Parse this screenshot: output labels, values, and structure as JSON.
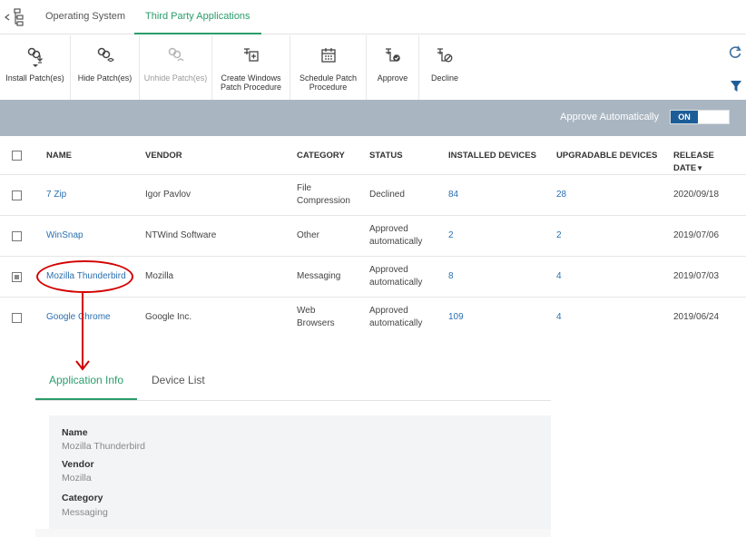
{
  "tabs": [
    {
      "label": "Operating System"
    },
    {
      "label": "Third Party Applications"
    }
  ],
  "toolbar": {
    "install": "Install Patch(es)",
    "hide": "Hide Patch(es)",
    "unhide": "Unhide Patch(es)",
    "create_windows_1": "Create Windows",
    "create_windows_2": "Patch Procedure",
    "schedule_1": "Schedule Patch",
    "schedule_2": "Procedure",
    "approve": "Approve",
    "decline": "Decline"
  },
  "auto": {
    "label": "Approve Automatically",
    "toggle": "ON"
  },
  "table": {
    "headers": {
      "name": "NAME",
      "vendor": "VENDOR",
      "category": "CATEGORY",
      "status": "STATUS",
      "installed": "INSTALLED DEVICES",
      "upgradable": "UPGRADABLE DEVICES",
      "release": "RELEASE DATE",
      "sort": "▼"
    },
    "rows": [
      {
        "name": "7 Zip",
        "vendor": "Igor Pavlov",
        "category_1": "File",
        "category_2": "Compression",
        "status_1": "Declined",
        "status_2": "",
        "installed": "84",
        "upgradable": "28",
        "release": "2020/09/18",
        "checked": false
      },
      {
        "name": "WinSnap",
        "vendor": "NTWind Software",
        "category_1": "Other",
        "category_2": "",
        "status_1": "Approved",
        "status_2": "automatically",
        "installed": "2",
        "upgradable": "2",
        "release": "2019/07/06",
        "checked": false
      },
      {
        "name": "Mozilla Thunderbird",
        "vendor": "Mozilla",
        "category_1": "Messaging",
        "category_2": "",
        "status_1": "Approved",
        "status_2": "automatically",
        "installed": "8",
        "upgradable": "4",
        "release": "2019/07/03",
        "checked": true
      },
      {
        "name": "Google Chrome",
        "vendor": "Google Inc.",
        "category_1": "Web",
        "category_2": "Browsers",
        "status_1": "Approved",
        "status_2": "automatically",
        "installed": "109",
        "upgradable": "4",
        "release": "2019/06/24",
        "checked": false
      }
    ]
  },
  "details": {
    "tabs": [
      "Application Info",
      "Device List"
    ],
    "name_label": "Name",
    "name_value": "Mozilla Thunderbird",
    "vendor_label": "Vendor",
    "vendor_value": "Mozilla",
    "category_label": "Category",
    "category_value": "Messaging"
  },
  "colors": {
    "accent_green": "#2a9d6b",
    "link_blue": "#2a6fb0",
    "toggle_blue": "#1c5d98",
    "annotation_red": "#d40000",
    "bar_gray": "#a9b6c2"
  }
}
